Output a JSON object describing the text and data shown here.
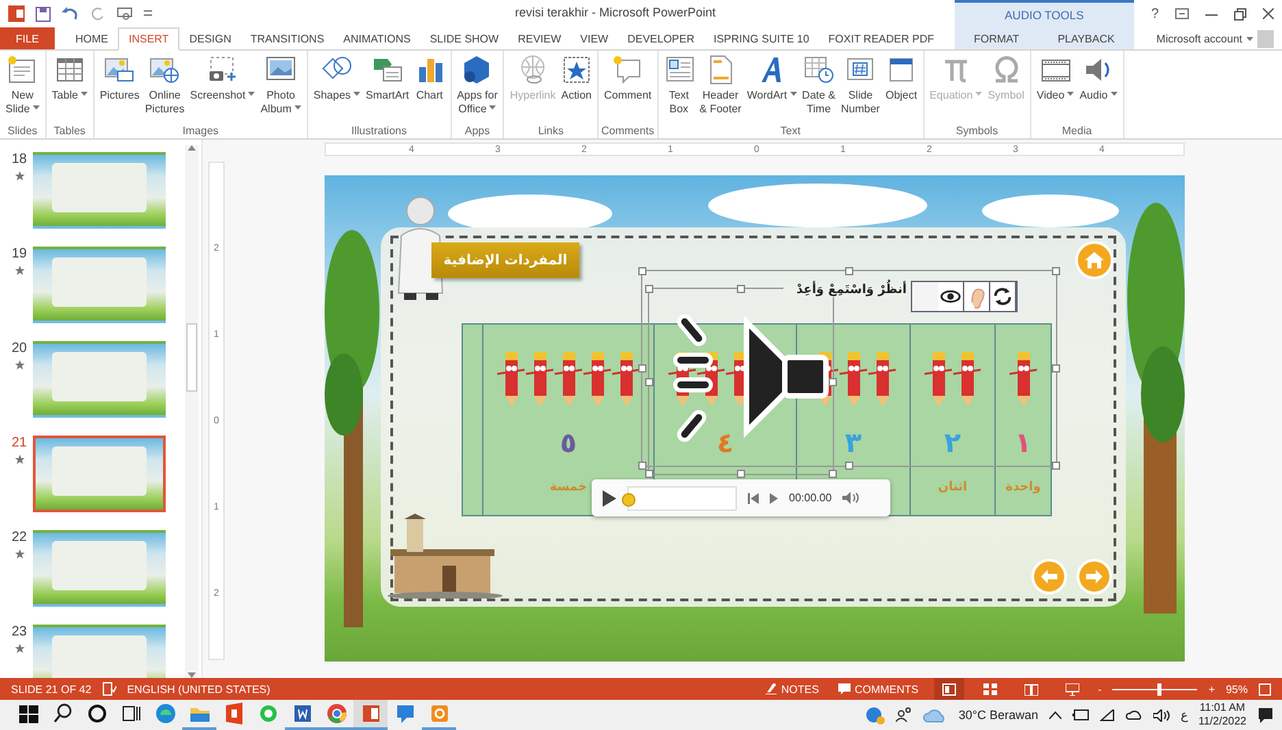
{
  "window": {
    "title": "revisi terakhir - Microsoft PowerPoint",
    "help": "?"
  },
  "tabs": [
    {
      "label": "FILE",
      "kind": "file",
      "selected": false
    },
    {
      "label": "HOME",
      "kind": "main",
      "selected": false
    },
    {
      "label": "INSERT",
      "kind": "main",
      "selected": true
    },
    {
      "label": "DESIGN",
      "kind": "main",
      "selected": false
    },
    {
      "label": "TRANSITIONS",
      "kind": "main",
      "selected": false
    },
    {
      "label": "ANIMATIONS",
      "kind": "main",
      "selected": false
    },
    {
      "label": "SLIDE SHOW",
      "kind": "main",
      "selected": false
    },
    {
      "label": "REVIEW",
      "kind": "main",
      "selected": false
    },
    {
      "label": "VIEW",
      "kind": "main",
      "selected": false
    },
    {
      "label": "DEVELOPER",
      "kind": "main",
      "selected": false
    },
    {
      "label": "ISPRING SUITE 10",
      "kind": "main",
      "selected": false
    },
    {
      "label": "FOXIT READER PDF",
      "kind": "main",
      "selected": false
    }
  ],
  "contextual": {
    "title": "AUDIO TOOLS",
    "tabs": [
      {
        "label": "FORMAT",
        "selected": false
      },
      {
        "label": "PLAYBACK",
        "selected": false
      }
    ]
  },
  "account": {
    "label": "Microsoft account"
  },
  "ribbon": {
    "groups": [
      {
        "label": "Slides",
        "buttons": [
          {
            "kind": "new-slide",
            "label": "New\nSlide",
            "dropdown": true,
            "disabled": false
          }
        ]
      },
      {
        "label": "Tables",
        "buttons": [
          {
            "kind": "table",
            "label": "Table",
            "dropdown": true,
            "disabled": false
          }
        ]
      },
      {
        "label": "Images",
        "buttons": [
          {
            "kind": "pictures",
            "label": "Pictures",
            "dropdown": false,
            "disabled": false
          },
          {
            "kind": "online-pictures",
            "label": "Online\nPictures",
            "dropdown": false,
            "disabled": false
          },
          {
            "kind": "screenshot",
            "label": "Screenshot",
            "dropdown": true,
            "disabled": false
          },
          {
            "kind": "photo-album",
            "label": "Photo\nAlbum",
            "dropdown": true,
            "disabled": false
          }
        ]
      },
      {
        "label": "Illustrations",
        "buttons": [
          {
            "kind": "shapes",
            "label": "Shapes",
            "dropdown": true,
            "disabled": false
          },
          {
            "kind": "smartart",
            "label": "SmartArt",
            "dropdown": false,
            "disabled": false
          },
          {
            "kind": "chart",
            "label": "Chart",
            "dropdown": false,
            "disabled": false
          }
        ]
      },
      {
        "label": "Apps",
        "buttons": [
          {
            "kind": "apps",
            "label": "Apps for\nOffice",
            "dropdown": true,
            "disabled": false
          }
        ]
      },
      {
        "label": "Links",
        "buttons": [
          {
            "kind": "hyperlink",
            "label": "Hyperlink",
            "dropdown": false,
            "disabled": true
          },
          {
            "kind": "action",
            "label": "Action",
            "dropdown": false,
            "disabled": false
          }
        ]
      },
      {
        "label": "Comments",
        "buttons": [
          {
            "kind": "comment",
            "label": "Comment",
            "dropdown": false,
            "disabled": false
          }
        ]
      },
      {
        "label": "Text",
        "buttons": [
          {
            "kind": "text-box",
            "label": "Text\nBox",
            "dropdown": false,
            "disabled": false
          },
          {
            "kind": "header-footer",
            "label": "Header\n& Footer",
            "dropdown": false,
            "disabled": false
          },
          {
            "kind": "wordart",
            "label": "WordArt",
            "dropdown": true,
            "disabled": false
          },
          {
            "kind": "date-time",
            "label": "Date &\nTime",
            "dropdown": false,
            "disabled": false
          },
          {
            "kind": "slide-number",
            "label": "Slide\nNumber",
            "dropdown": false,
            "disabled": false
          },
          {
            "kind": "object",
            "label": "Object",
            "dropdown": false,
            "disabled": false
          }
        ]
      },
      {
        "label": "Symbols",
        "buttons": [
          {
            "kind": "equation",
            "label": "Equation",
            "dropdown": true,
            "disabled": true
          },
          {
            "kind": "symbol",
            "label": "Symbol",
            "dropdown": false,
            "disabled": true
          }
        ]
      },
      {
        "label": "Media",
        "buttons": [
          {
            "kind": "video",
            "label": "Video",
            "dropdown": true,
            "disabled": false
          },
          {
            "kind": "audio",
            "label": "Audio",
            "dropdown": true,
            "disabled": false
          }
        ]
      }
    ]
  },
  "slides_panel": {
    "slides": [
      {
        "number": "18",
        "selected": false
      },
      {
        "number": "19",
        "selected": false
      },
      {
        "number": "20",
        "selected": false
      },
      {
        "number": "21",
        "selected": true
      },
      {
        "number": "22",
        "selected": false
      },
      {
        "number": "23",
        "selected": false
      }
    ]
  },
  "rulers": {
    "horizontal": [
      "4",
      "3",
      "2",
      "1",
      "0",
      "1",
      "2",
      "3",
      "4"
    ],
    "vertical": [
      "2",
      "1",
      "0",
      "1",
      "2"
    ]
  },
  "slide": {
    "banner": "المفردات الإضافية",
    "instruction": "أنظُرْ وَاسْتَمِعْ وَأعِدْ",
    "columns": [
      {
        "number": "١",
        "color": "#e0527c",
        "word": "واحدة"
      },
      {
        "number": "٢",
        "color": "#39a3dc",
        "word": "اثنان"
      },
      {
        "number": "٣",
        "color": "#39a3dc"
      },
      {
        "number": "٤",
        "color": "#e07a22"
      },
      {
        "number": "٥",
        "color": "#6b5aa0",
        "word": "خمسة"
      }
    ],
    "audio": {
      "selected": true,
      "time": "00:00.00",
      "level": 0
    }
  },
  "status_bar": {
    "slide": "SLIDE 21 OF 42",
    "language": "ENGLISH (UNITED STATES)",
    "notes": "NOTES",
    "comments": "COMMENTS",
    "views": [
      {
        "kind": "normal",
        "selected": true
      },
      {
        "kind": "sorter",
        "selected": false
      },
      {
        "kind": "reading",
        "selected": false
      },
      {
        "kind": "show",
        "selected": false
      }
    ],
    "zoom": {
      "minus": "-",
      "plus": "+",
      "level": 0.55,
      "value": "95%"
    }
  },
  "taskbar": {
    "apps": [
      {
        "kind": "start",
        "running": false,
        "selected": false
      },
      {
        "kind": "search",
        "running": false,
        "selected": false
      },
      {
        "kind": "cortana",
        "running": false,
        "selected": false
      },
      {
        "kind": "task-view",
        "running": false,
        "selected": false
      },
      {
        "kind": "edge",
        "running": false,
        "selected": false
      },
      {
        "kind": "explorer",
        "running": true,
        "selected": false
      },
      {
        "kind": "office",
        "running": false,
        "selected": false
      },
      {
        "kind": "whatsapp",
        "running": false,
        "selected": false
      },
      {
        "kind": "word",
        "running": true,
        "selected": false
      },
      {
        "kind": "chrome",
        "running": true,
        "selected": false
      },
      {
        "kind": "powerpoint",
        "running": true,
        "selected": true
      },
      {
        "kind": "chat",
        "running": false,
        "selected": false
      },
      {
        "kind": "orange-app",
        "running": true,
        "selected": false
      }
    ],
    "tray": {
      "weather": "30°C Berawan",
      "input": "ع",
      "time": "11:01 AM",
      "date": "11/2/2022"
    }
  }
}
